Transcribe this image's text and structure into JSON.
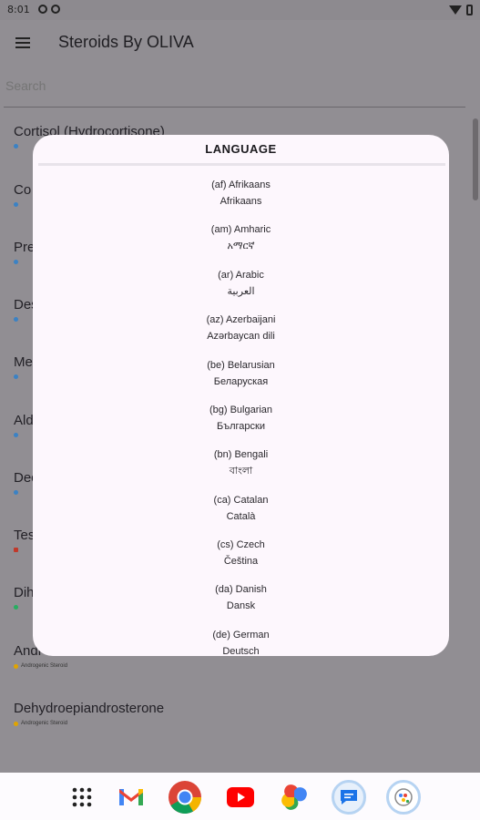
{
  "status_bar": {
    "time": "8:01"
  },
  "app_bar": {
    "title": "Steroids By OLIVA"
  },
  "search": {
    "placeholder": "Search"
  },
  "list": {
    "items": [
      {
        "name": "Cortisol (Hydrocortisone)",
        "dot_color": "#3b82c4"
      },
      {
        "name": "Co",
        "dot_color": "#3b82c4"
      },
      {
        "name": "Pre",
        "dot_color": "#3b82c4"
      },
      {
        "name": "Des",
        "dot_color": "#3b82c4"
      },
      {
        "name": "Me",
        "dot_color": "#3b82c4"
      },
      {
        "name": "Ald",
        "dot_color": "#3b82c4"
      },
      {
        "name": "Dec",
        "dot_color": "#3b82c4"
      },
      {
        "name": "Tes",
        "dot_color": "#c0392b"
      },
      {
        "name": "Dih",
        "dot_color": "#27ae60"
      },
      {
        "name": "Andr",
        "sub": "Androgenic Steroid",
        "dot_color": "#e0a400"
      },
      {
        "name": "Dehydroepiandrosterone",
        "sub": "Androgenic Steroid",
        "dot_color": "#e0a400"
      }
    ]
  },
  "dialog": {
    "title": "LANGUAGE",
    "languages": [
      {
        "code": "(af) Afrikaans",
        "native": "Afrikaans"
      },
      {
        "code": "(am) Amharic",
        "native": "አማርኛ"
      },
      {
        "code": "(ar) Arabic",
        "native": "العربية"
      },
      {
        "code": "(az) Azerbaijani",
        "native": "Azərbaycan dili"
      },
      {
        "code": "(be) Belarusian",
        "native": "Беларуская"
      },
      {
        "code": "(bg) Bulgarian",
        "native": "Български"
      },
      {
        "code": "(bn) Bengali",
        "native": "বাংলা"
      },
      {
        "code": "(ca) Catalan",
        "native": "Català"
      },
      {
        "code": "(cs) Czech",
        "native": "Čeština"
      },
      {
        "code": "(da) Danish",
        "native": "Dansk"
      },
      {
        "code": "(de) German",
        "native": "Deutsch"
      }
    ]
  },
  "nav": {
    "apps": [
      "app-drawer",
      "gmail",
      "chrome",
      "youtube",
      "photos",
      "messages",
      "assistant"
    ]
  }
}
